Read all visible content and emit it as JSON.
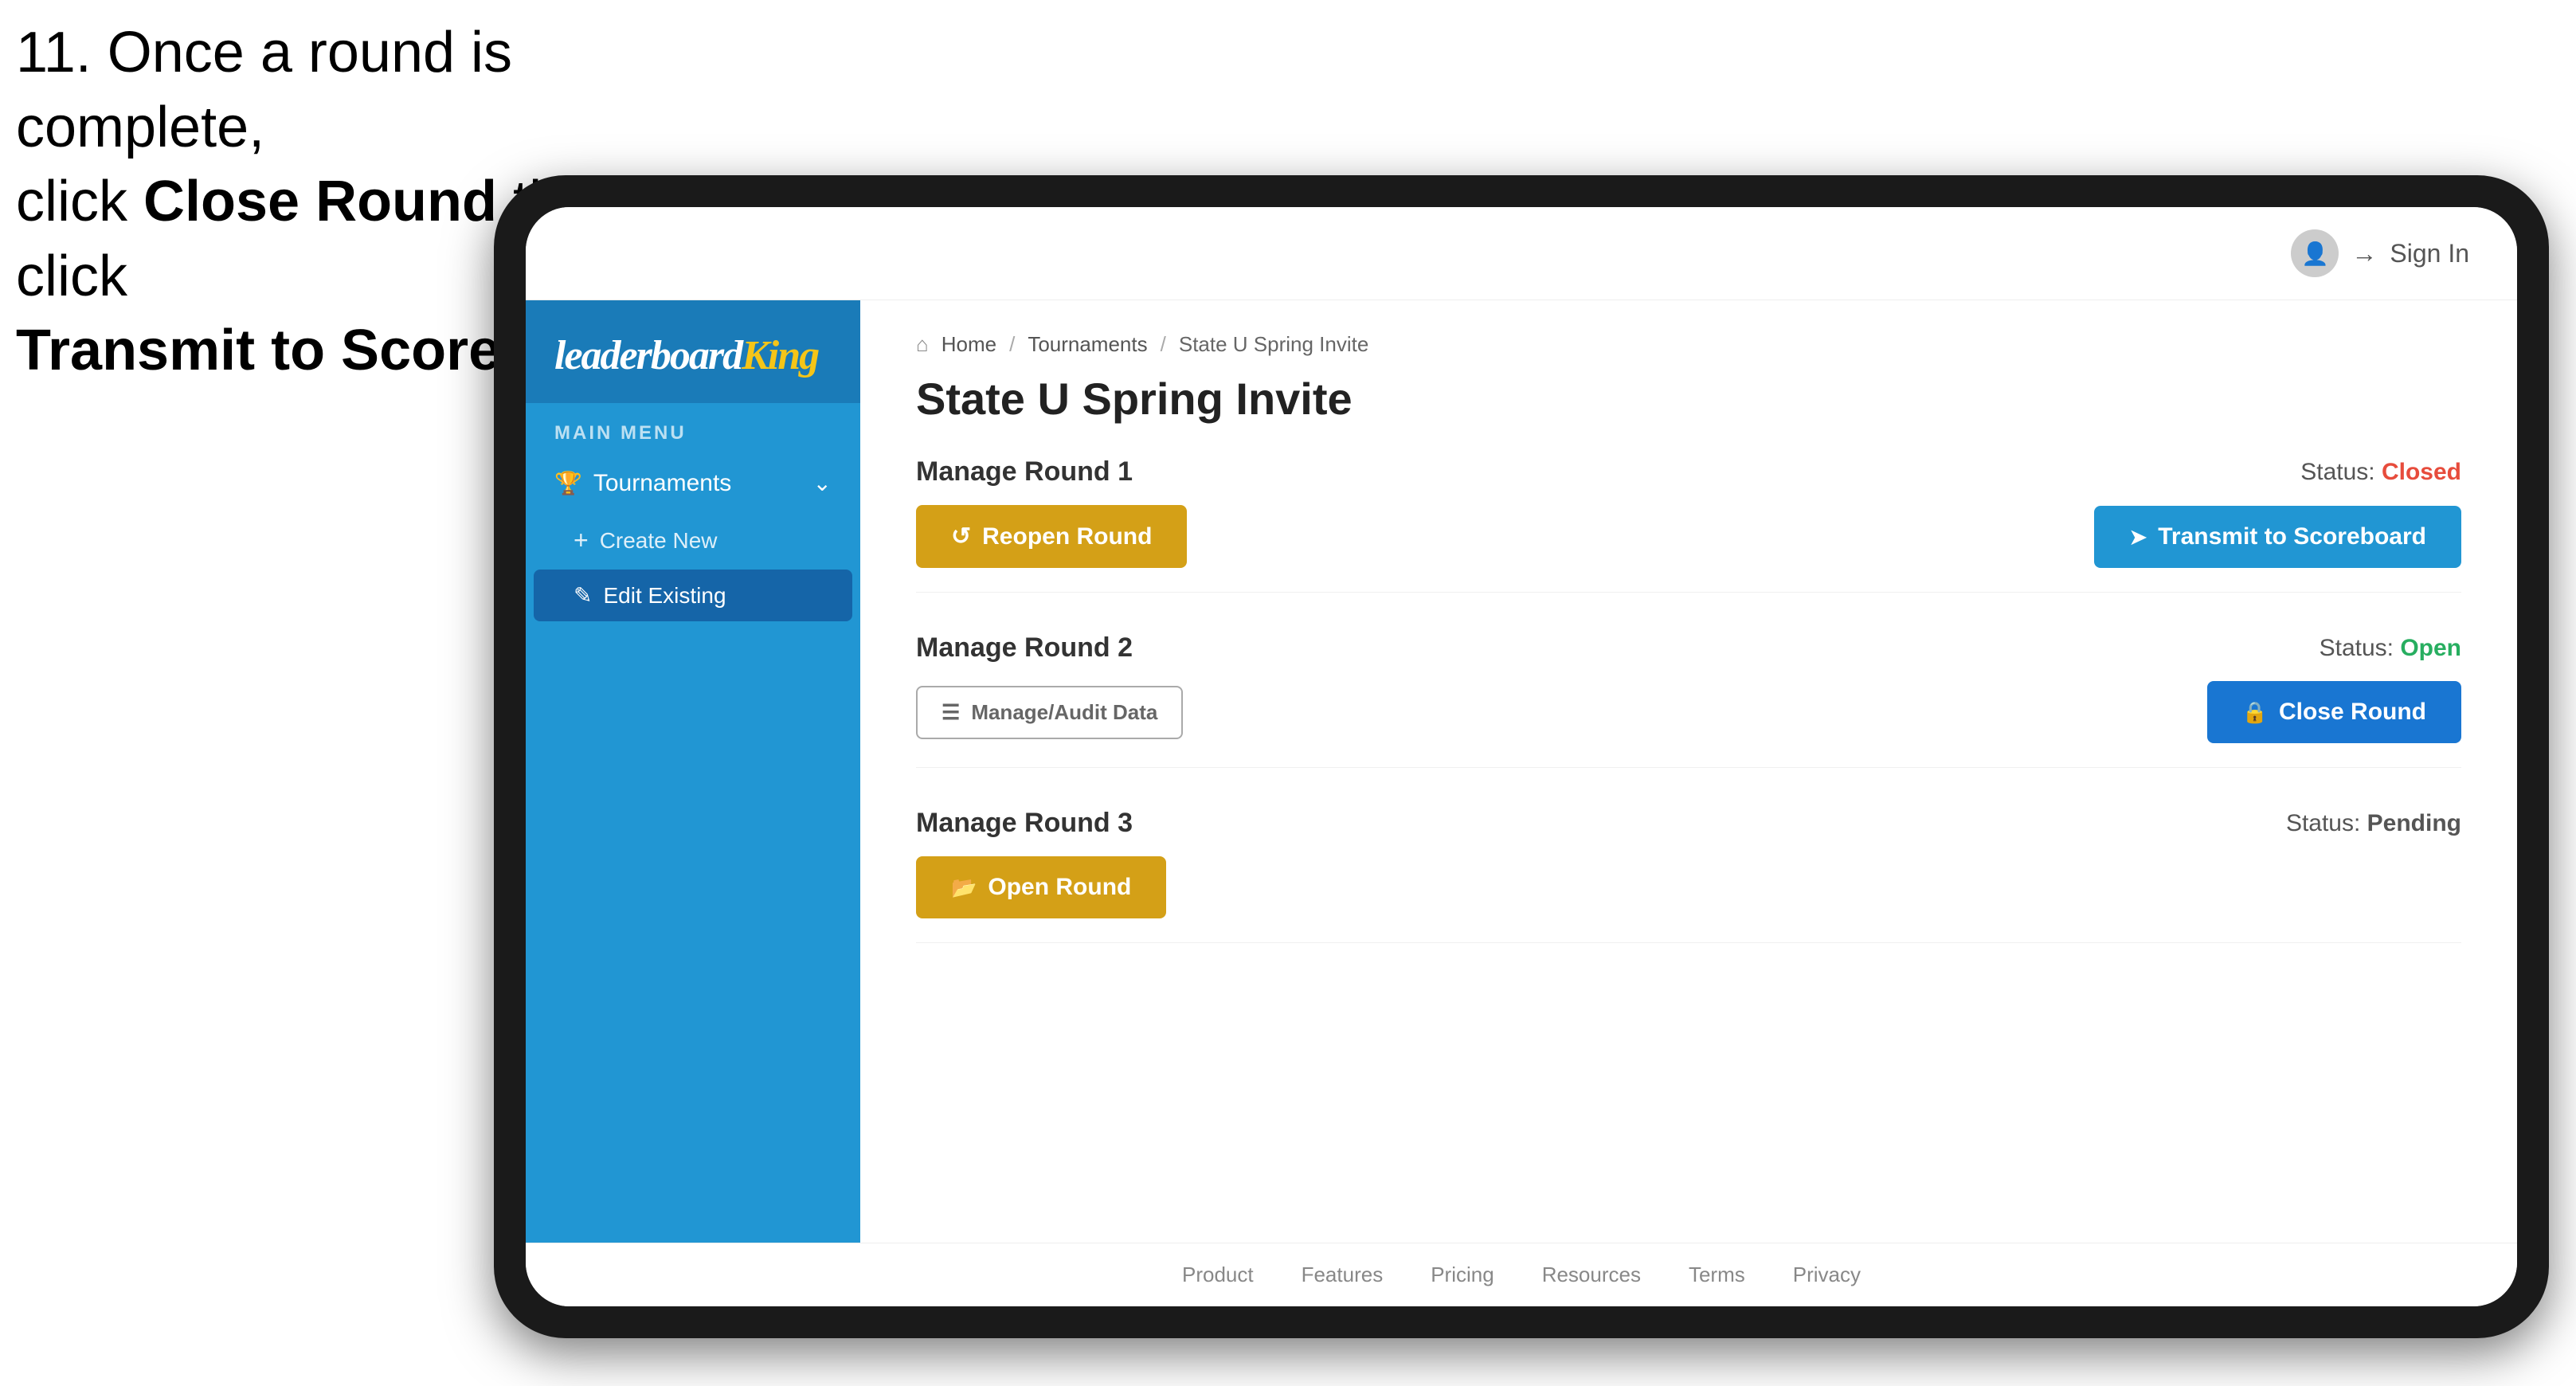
{
  "instruction": {
    "line1": "11. Once a round is complete,",
    "line2_prefix": "click ",
    "line2_bold": "Close Round",
    "line2_suffix": " then click",
    "line3": "Transmit to Scoreboard."
  },
  "header": {
    "sign_in_label": "Sign In",
    "avatar_icon": "person-icon"
  },
  "sidebar": {
    "logo_leaderboard": "leaderboard",
    "logo_king": "King",
    "main_menu_label": "MAIN MENU",
    "tournaments_label": "Tournaments",
    "create_new_label": "Create New",
    "edit_existing_label": "Edit Existing"
  },
  "breadcrumb": {
    "home": "Home",
    "separator1": "/",
    "tournaments": "Tournaments",
    "separator2": "/",
    "current": "State U Spring Invite"
  },
  "page": {
    "title": "State U Spring Invite"
  },
  "rounds": [
    {
      "title": "Manage Round 1",
      "status_label": "Status:",
      "status_value": "Closed",
      "status_class": "status-closed",
      "left_button_label": "Reopen Round",
      "left_button_type": "btn-gold",
      "right_button_label": "Transmit to Scoreboard",
      "right_button_type": "btn-blue"
    },
    {
      "title": "Manage Round 2",
      "status_label": "Status:",
      "status_value": "Open",
      "status_class": "status-open",
      "left_button_label": "Manage/Audit Data",
      "left_button_type": "btn-outline",
      "right_button_label": "Close Round",
      "right_button_type": "btn-blue-dark"
    },
    {
      "title": "Manage Round 3",
      "status_label": "Status:",
      "status_value": "Pending",
      "status_class": "status-pending",
      "left_button_label": "Open Round",
      "left_button_type": "btn-gold",
      "right_button_label": null,
      "right_button_type": null
    }
  ],
  "footer": {
    "links": [
      "Product",
      "Features",
      "Pricing",
      "Resources",
      "Terms",
      "Privacy"
    ]
  }
}
